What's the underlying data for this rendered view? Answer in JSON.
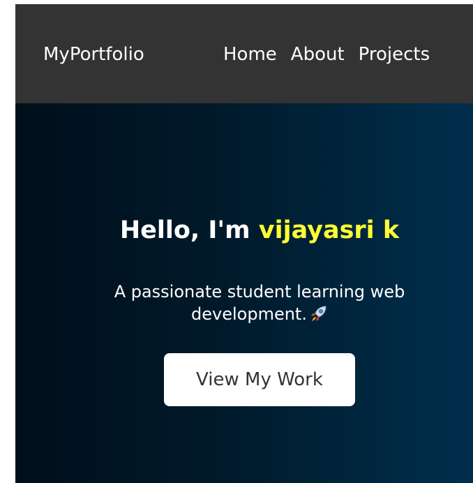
{
  "navbar": {
    "brand": "MyPortfolio",
    "links": [
      "Home",
      "About",
      "Projects"
    ]
  },
  "hero": {
    "greeting": "Hello, I'm ",
    "name": "vijayasri k",
    "subtitle": "A passionate student learning web development.",
    "cta_label": "View My Work",
    "subtitle_icon": "rocket-icon"
  },
  "colors": {
    "navbar_bg": "#333333",
    "hero_gradient_start": "#000f1a",
    "hero_gradient_end": "#002f4d",
    "name_highlight": "#ffff33",
    "button_bg": "#ffffff"
  }
}
